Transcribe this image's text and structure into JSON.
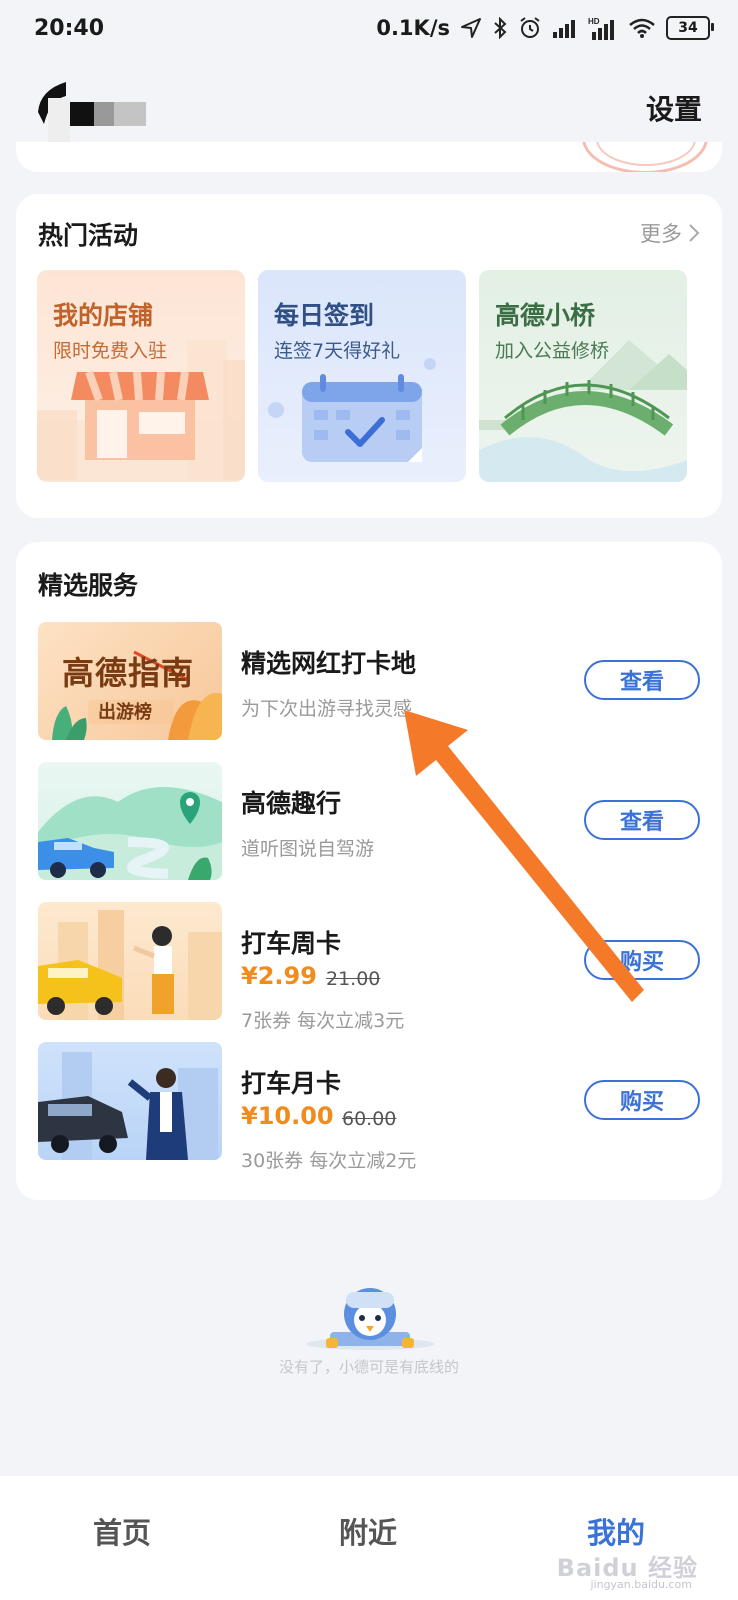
{
  "status_bar": {
    "time": "20:40",
    "network_speed": "0.1K/s",
    "battery_level": "34",
    "icons": [
      "location-icon",
      "bluetooth-icon",
      "alarm-icon",
      "signal-icon",
      "hd-signal-icon",
      "wifi-icon",
      "battery-icon"
    ]
  },
  "header": {
    "settings_label": "设置"
  },
  "hot_activities": {
    "title": "热门活动",
    "more_label": "更多",
    "items": [
      {
        "title": "我的店铺",
        "subtitle": "限时免费入驻",
        "title_color": "#c0622a",
        "subtitle_color": "#c66a33"
      },
      {
        "title": "每日签到",
        "subtitle": "连签7天得好礼",
        "title_color": "#2f4f86",
        "subtitle_color": "#3c5a8c"
      },
      {
        "title": "高德小桥",
        "subtitle": "加入公益修桥",
        "title_color": "#3c6e45",
        "subtitle_color": "#4b7a54"
      }
    ]
  },
  "selected_services": {
    "title": "精选服务",
    "items": [
      {
        "title": "精选网红打卡地",
        "desc": "为下次出游寻找灵感",
        "button": "查看",
        "thumb_text": "高德指南",
        "thumb_badge": "出游榜"
      },
      {
        "title": "高德趣行",
        "desc": "道听图说自驾游",
        "button": "查看"
      },
      {
        "title": "打车周卡",
        "price": "¥2.99",
        "old_price": "21.00",
        "desc": "7张券 每次立减3元",
        "button": "购买"
      },
      {
        "title": "打车月卡",
        "price": "¥10.00",
        "old_price": "60.00",
        "desc": "30张券 每次立减2元",
        "button": "购买"
      }
    ]
  },
  "footer": {
    "end_text": "没有了，小德可是有底线的"
  },
  "bottom_nav": {
    "items": [
      {
        "label": "首页",
        "active": false
      },
      {
        "label": "附近",
        "active": false
      },
      {
        "label": "我的",
        "active": true
      }
    ]
  },
  "watermark": {
    "text": "Baidu 经验",
    "sub": "jingyan.baidu.com"
  },
  "colors": {
    "accent": "#3b72d6",
    "price": "#f08b1e",
    "arrow": "#f47a2a"
  }
}
